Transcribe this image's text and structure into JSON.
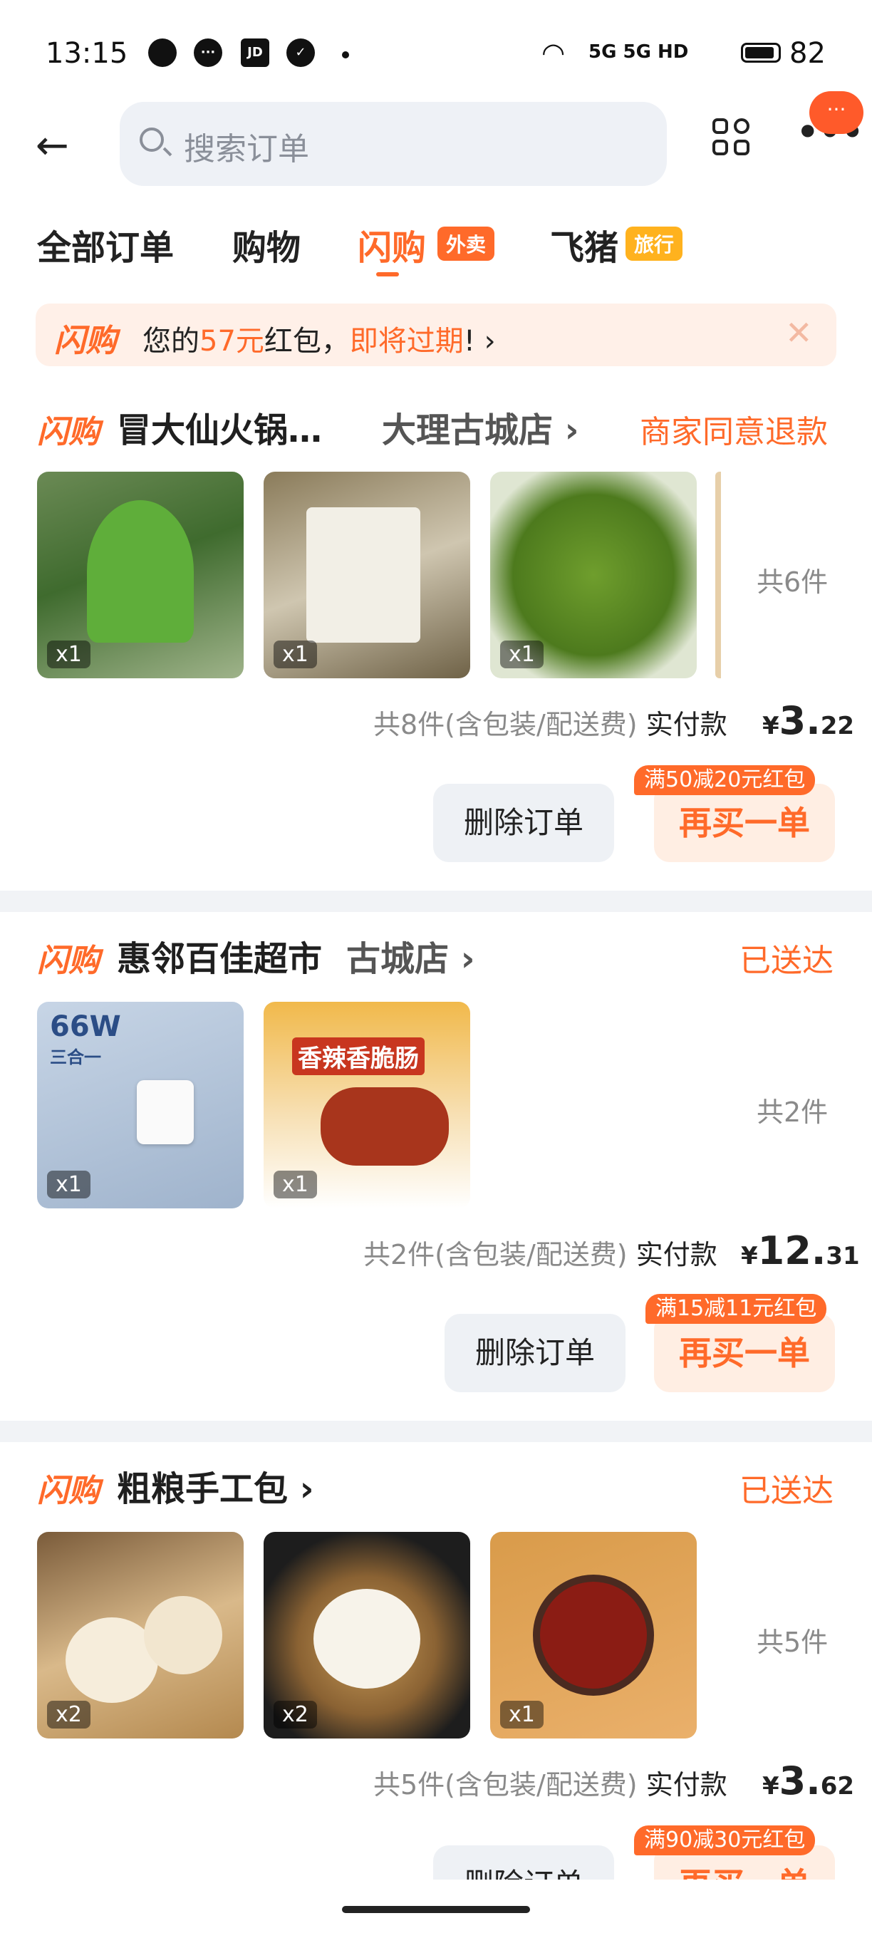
{
  "status_bar": {
    "time": "13:15",
    "icons": [
      "bubble-icon",
      "chat-icon",
      "jd-icon",
      "app-icon"
    ],
    "jd_label": "JD",
    "network": "5G 5G HD",
    "battery": "82"
  },
  "header": {
    "search_placeholder": "搜索订单",
    "more_badge": "···"
  },
  "tabs": [
    {
      "label": "全部订单"
    },
    {
      "label": "购物"
    },
    {
      "label": "闪购",
      "tag": "外卖"
    },
    {
      "label": "飞猪",
      "tag": "旅行"
    }
  ],
  "banner": {
    "logo": "闪购",
    "text_prefix": "您的",
    "amount": "57元",
    "text_mid": "红包，",
    "warning": "即将过期",
    "text_suffix": "! ›",
    "close": "✕"
  },
  "orders": [
    {
      "logo": "闪购",
      "store": "冒大仙火锅…",
      "branch": "大理古城店 ›",
      "status": "商家同意退款",
      "qtys": [
        "x1",
        "x1",
        "x1"
      ],
      "item_count": "共6件",
      "summary": "共8件(含包装/配送费)",
      "pay_label": "实付款",
      "price_symbol": "¥",
      "price_int": "3.",
      "price_dec": "22",
      "delete_label": "删除订单",
      "rebuy_label": "再买一单",
      "coupon": "满50减20元红包"
    },
    {
      "logo": "闪购",
      "store": "惠邻百佳超市",
      "branch": "古城店 ›",
      "status": "已送达",
      "qtys": [
        "x1",
        "x1"
      ],
      "item_count": "共2件",
      "summary": "共2件(含包装/配送费)",
      "pay_label": "实付款",
      "price_symbol": "¥",
      "price_int": "12.",
      "price_dec": "31",
      "delete_label": "删除订单",
      "rebuy_label": "再买一单",
      "coupon": "满15减11元红包",
      "charger_text": "66W",
      "charger_sub": "三合一",
      "sausage_text": "香辣香脆肠"
    },
    {
      "logo": "闪购",
      "store": "粗粮手工包 ›",
      "status": "已送达",
      "qtys": [
        "x2",
        "x2",
        "x1"
      ],
      "item_count": "共5件",
      "summary": "共5件(含包装/配送费)",
      "pay_label": "实付款",
      "price_symbol": "¥",
      "price_int": "3.",
      "price_dec": "62",
      "delete_label": "删除订单",
      "rebuy_label": "再买一单",
      "coupon": "满90减30元红包"
    }
  ],
  "colors": {
    "accent": "#ff6a2a",
    "tag_yellow": "#ffb21e",
    "bg_sep": "#f1f3f6"
  }
}
